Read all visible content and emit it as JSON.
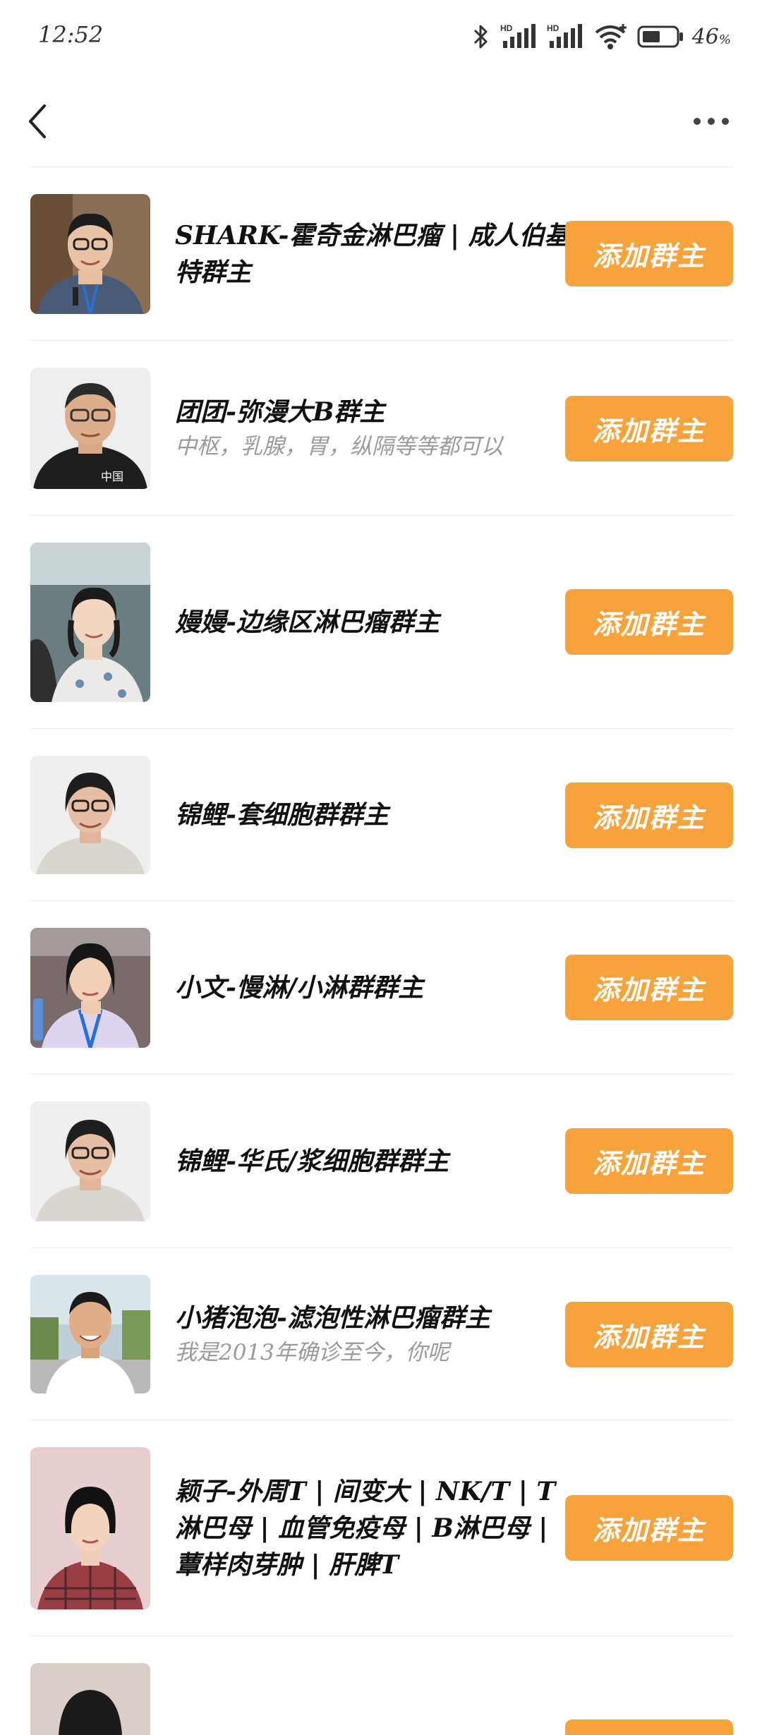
{
  "status_bar": {
    "time": "12:52",
    "battery_percent": "46",
    "battery_unit": "%",
    "network_labels": [
      "HD",
      "HD"
    ]
  },
  "nav": {
    "back_icon": "chevron-left-icon",
    "more_icon": "more-dots-icon"
  },
  "colors": {
    "accent": "#f7a23b",
    "title_text": "#111111",
    "subtitle_text": "#9a9a9a",
    "divider": "#ececec"
  },
  "items": [
    {
      "title": "SHARK-霍奇金淋巴瘤 | 成人伯基特群主",
      "subtitle": "",
      "button": "添加群主"
    },
    {
      "title": "团团-弥漫大B群主",
      "subtitle": "中枢，乳腺，胃，纵隔等等都可以",
      "button": "添加群主"
    },
    {
      "title": "嫚嫚-边缘区淋巴瘤群主",
      "subtitle": "",
      "button": "添加群主"
    },
    {
      "title": "锦鲤-套细胞群群主",
      "subtitle": "",
      "button": "添加群主"
    },
    {
      "title": "小文-慢淋/小淋群群主",
      "subtitle": "",
      "button": "添加群主"
    },
    {
      "title": "锦鲤-华氏/浆细胞群群主",
      "subtitle": "",
      "button": "添加群主"
    },
    {
      "title": "小猪泡泡-滤泡性淋巴瘤群主",
      "subtitle": "我是2013年确诊至今，你呢",
      "button": "添加群主"
    },
    {
      "title": "颖子-外周T | 间变大 | NK/T | T淋巴母 | 血管免疫母 | B淋巴母 | 蕈样肉芽肿 | 肝脾T",
      "subtitle": "",
      "button": "添加群主"
    }
  ]
}
